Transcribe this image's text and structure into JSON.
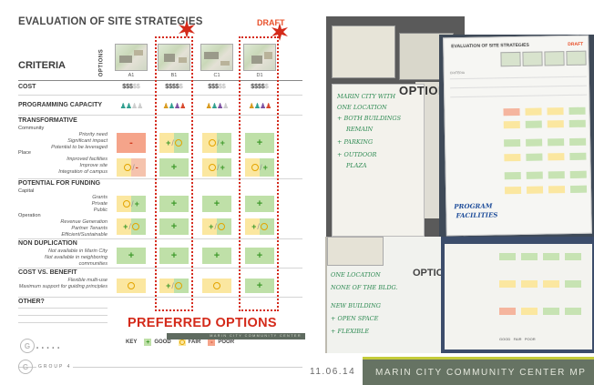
{
  "evaluation": {
    "title": "EVALUATION OF SITE STRATEGIES",
    "draft_label": "DRAFT",
    "options_label": "OPTIONS",
    "criteria_label": "CRITERIA",
    "columns": [
      {
        "code": "A1",
        "cost_main": "$$$",
        "cost_dim": "$$"
      },
      {
        "code": "B1",
        "cost_main": "$$$$",
        "cost_dim": "$"
      },
      {
        "code": "C1",
        "cost_main": "$$$",
        "cost_dim": "$$"
      },
      {
        "code": "D1",
        "cost_main": "$$$$",
        "cost_dim": "$"
      }
    ],
    "rows": {
      "cost": "COST",
      "programming_capacity": "PROGRAMMING CAPACITY",
      "transformative": "TRANSFORMATIVE",
      "community": "Community",
      "priority_need": "Priority need",
      "significant_impact": "Significant impact",
      "potential_leveraged": "Potential to be leveraged",
      "place": "Place",
      "improved_facilities": "Improved facilities",
      "improve_site": "Improve site",
      "integration_campus": "Integration of campus",
      "potential_funding": "POTENTIAL FOR FUNDING",
      "capital": "Capital",
      "grants": "Grants",
      "private": "Private",
      "public": "Public",
      "operation": "Operation",
      "revenue_generation": "Revenue Generation",
      "partner_tenants": "Partner Tenants",
      "efficient_sustainable": "Efficient/Sustainable",
      "non_duplication": "NON DUPLICATION",
      "not_available_marin": "Not available in Marin City",
      "not_available_neighboring": "Not available in neighboring communities",
      "cost_vs_benefit": "COST VS. BENEFIT",
      "flexible_multi_use": "Flexible multi-use",
      "maximum_support": "Maximum support for guiding principles",
      "other": "OTHER?"
    },
    "preferred_options": "PREFERRED OPTIONS",
    "key": {
      "label": "KEY",
      "good": "GOOD",
      "fair": "FAIR",
      "poor": "POOR",
      "good_symbol": "+",
      "poor_symbol": "-"
    },
    "footer_bar": "MARIN CITY COMMUNITY CENTER"
  },
  "photos": {
    "photo_a_option_label": "OPTION D",
    "photo_c_option_label": "OPTION C",
    "photo_a_notes": [
      "MARIN CITY WITH",
      "ONE LOCATION",
      "+ BOTH BUILDINGS",
      "REMAIN",
      "+ PARKING",
      "+ OUTDOOR",
      "PLAZA"
    ],
    "photo_c_notes": [
      "ONE LOCATION",
      "NONE OF THE BLDG.",
      "NEW BUILDING",
      "+ OPEN SPACE",
      "+ FLEXIBLE"
    ],
    "photo_b_title": "EVALUATION OF SITE STRATEGIES",
    "photo_b_draft": "DRAFT",
    "photo_b_notes": [
      "PROGRAM",
      "FACILITIES"
    ],
    "photo_d_key": {
      "good": "GOOD",
      "fair": "FAIR",
      "poor": "POOR"
    }
  },
  "footer": {
    "group_text": "GROUP 4",
    "date": "11.06.14",
    "project_title": "MARIN CITY COMMUNITY CENTER MP"
  },
  "colors": {
    "good": "#3f9a2b",
    "fair": "#e3a400",
    "poor": "#d0381b",
    "accent_red": "#d42a1a",
    "footer_green": "#667363",
    "footer_accent": "#c4cc3a"
  }
}
